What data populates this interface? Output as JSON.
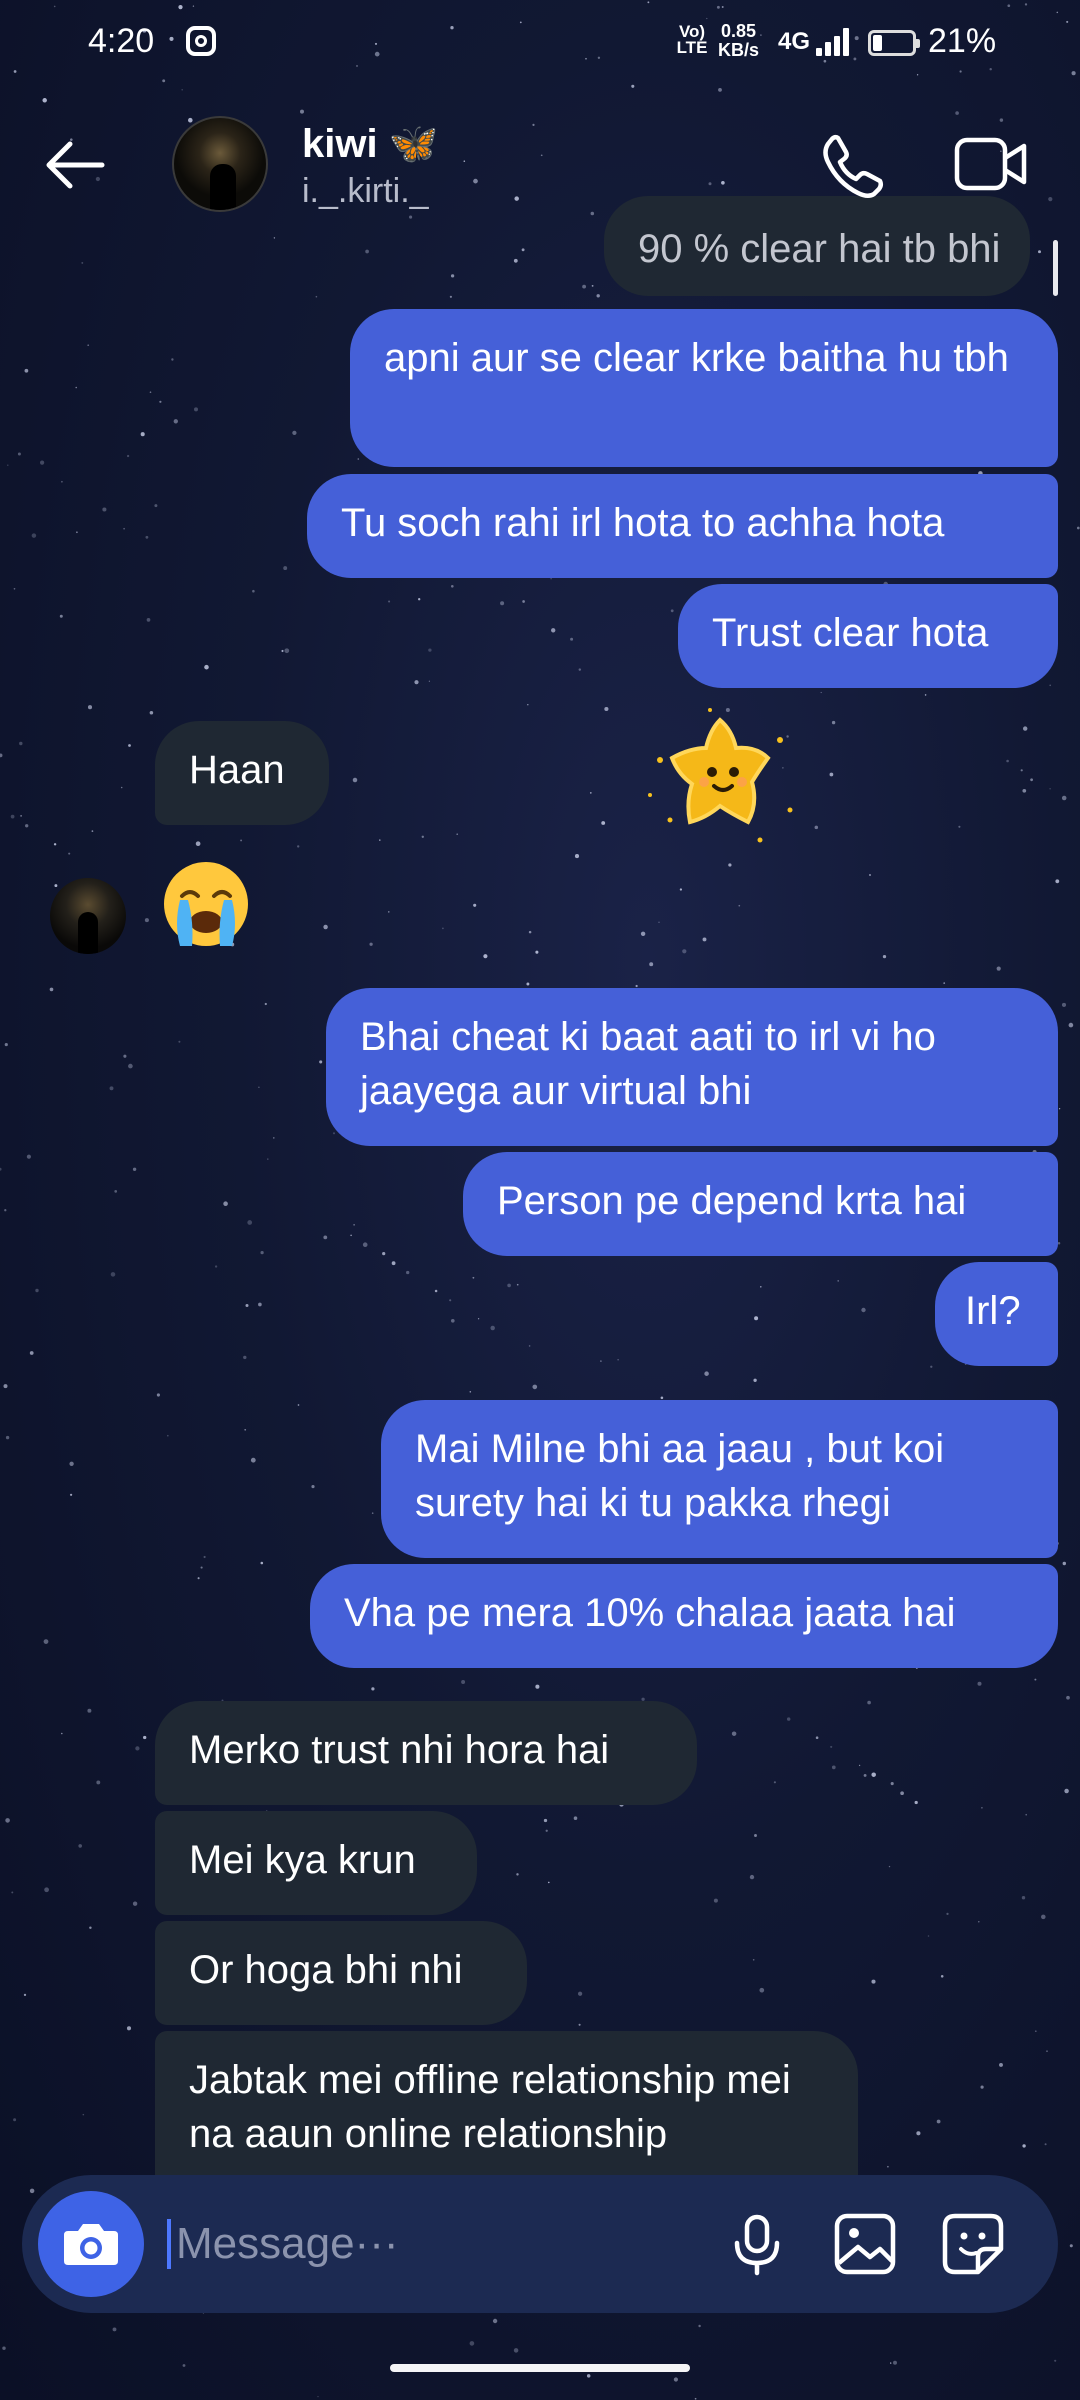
{
  "status_bar": {
    "time": "4:20",
    "volte": "Vo) LTE",
    "net_speed_value": "0.85",
    "net_speed_unit": "KB/s",
    "network": "4G",
    "battery": "21%"
  },
  "header": {
    "name": "kiwi 🦋",
    "username": "i._.kirti._"
  },
  "messages": [
    {
      "sender": "me",
      "text": "90 % clear hai tb bhi"
    },
    {
      "sender": "me",
      "text": "apni aur se clear krke baitha hu tbh"
    },
    {
      "sender": "me",
      "text": "Tu soch rahi irl hota to achha hota"
    },
    {
      "sender": "me",
      "text": "Trust clear hota"
    },
    {
      "sender": "them",
      "text": "Haan"
    },
    {
      "sender": "them",
      "emoji": "😭"
    },
    {
      "sender": "me",
      "text": "Bhai cheat ki baat aati to irl vi ho jaayega aur virtual bhi"
    },
    {
      "sender": "me",
      "text": "Person pe depend krta hai"
    },
    {
      "sender": "me",
      "text": "Irl?"
    },
    {
      "sender": "me",
      "text": "Mai Milne bhi aa jaau , but koi surety hai ki tu pakka rhegi"
    },
    {
      "sender": "me",
      "text": "Vha pe mera 10% chalaa jaata hai"
    },
    {
      "sender": "them",
      "text": "Merko trust nhi hora hai"
    },
    {
      "sender": "them",
      "text": "Mei kya krun"
    },
    {
      "sender": "them",
      "text": "Or hoga bhi nhi"
    },
    {
      "sender": "them",
      "text": "Jabtak mei offline relationship mei na aaun online relationship"
    }
  ],
  "composer": {
    "placeholder": "Message···"
  },
  "icons": {
    "back": "back-arrow-icon",
    "call": "phone-icon",
    "video": "video-camera-icon",
    "camera": "camera-icon",
    "mic": "microphone-icon",
    "gallery": "gallery-icon",
    "sticker": "sticker-icon"
  },
  "colors": {
    "my_bubble": "#4560d8",
    "their_bubble": "#1f2833",
    "composer": "#1c2a52",
    "camera_button": "#3e63e6"
  }
}
